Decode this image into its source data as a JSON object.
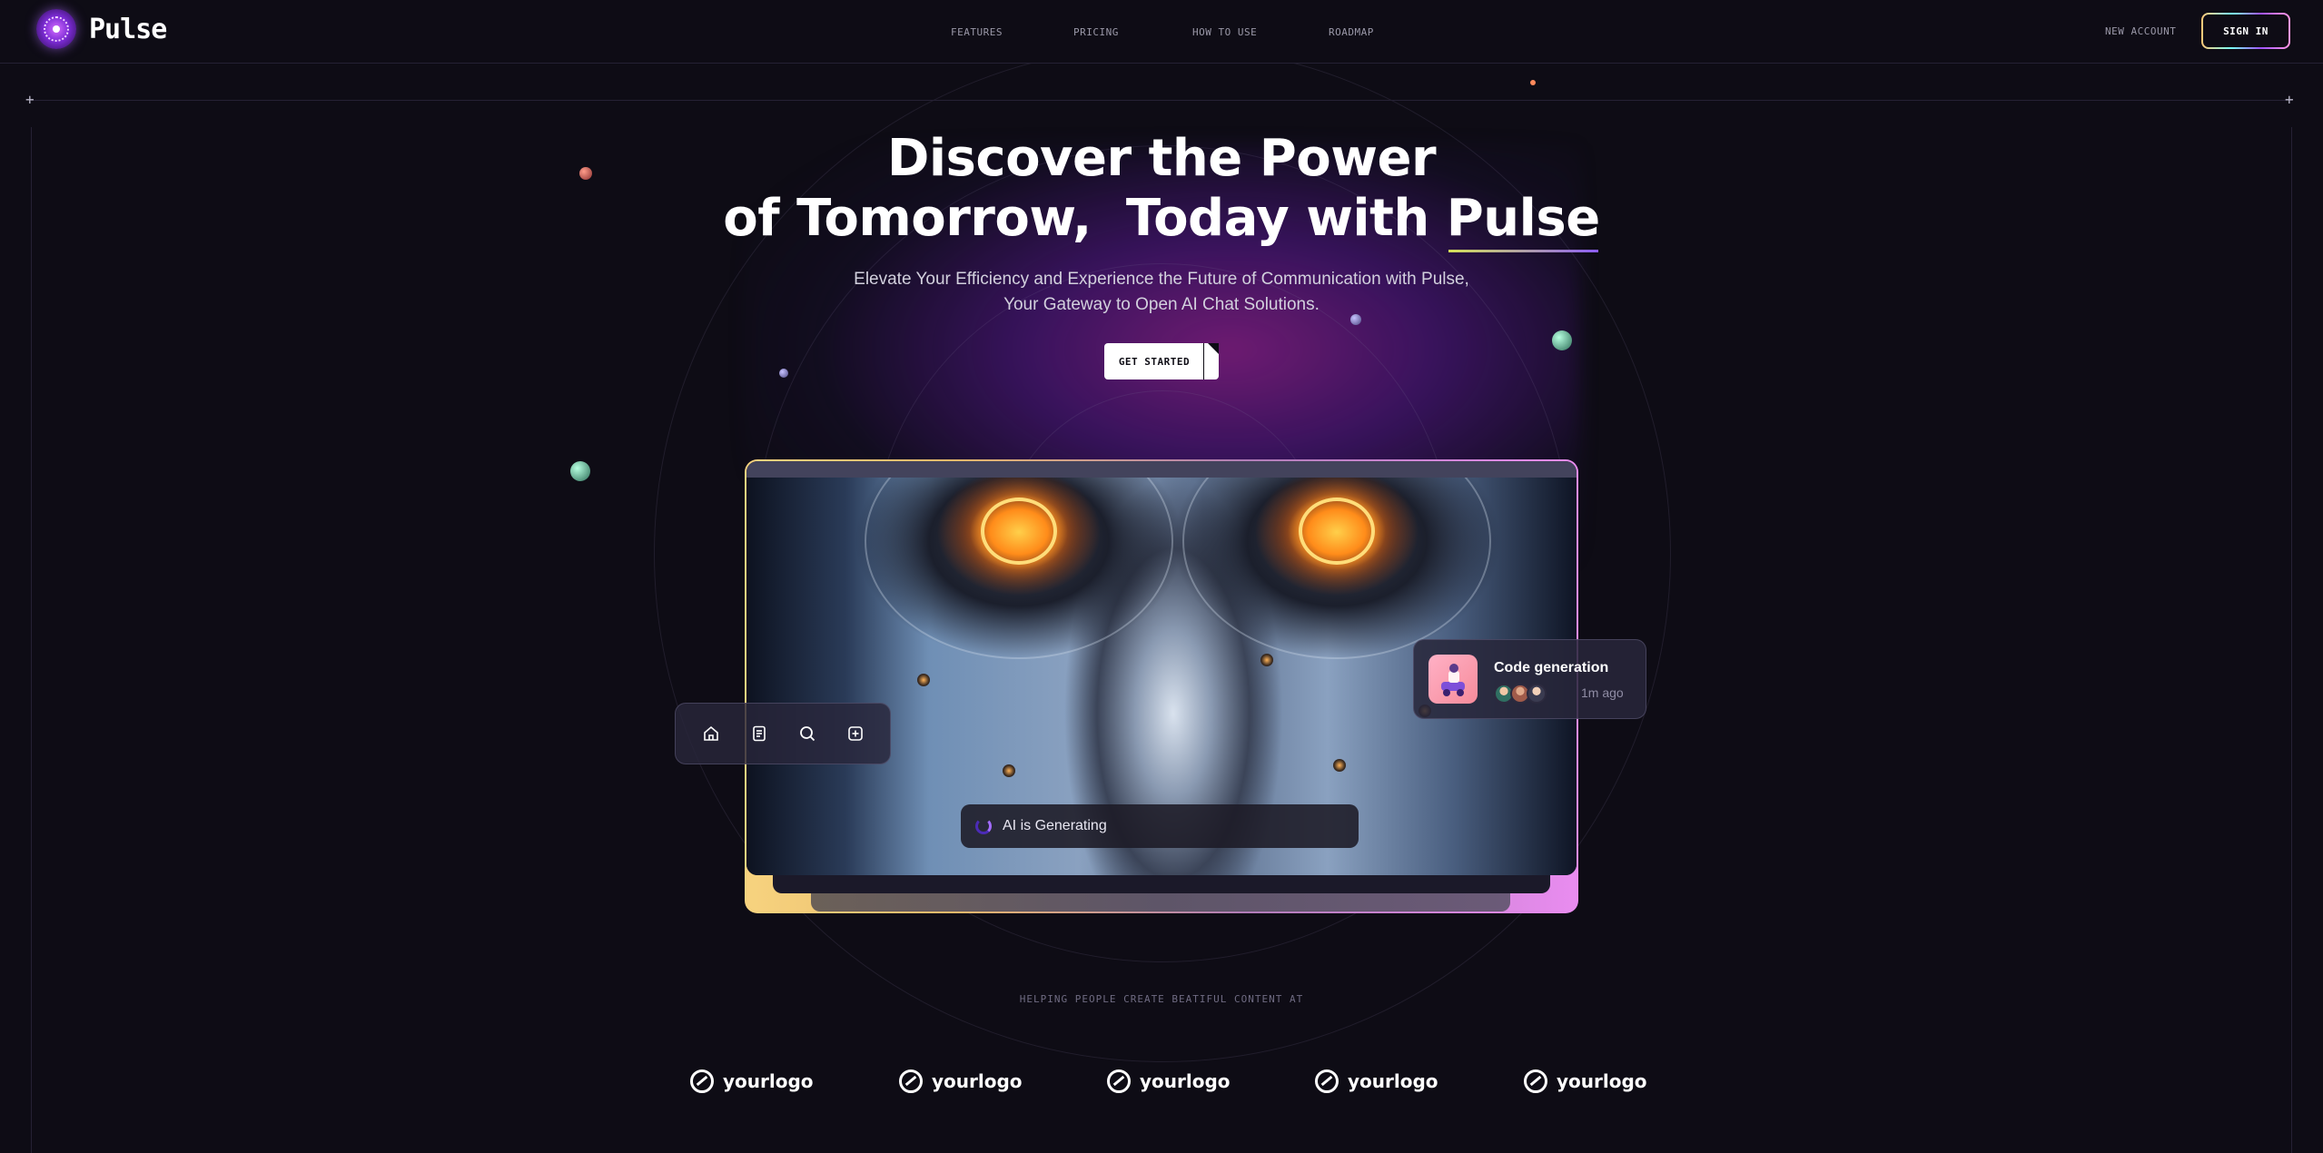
{
  "brand": {
    "name": "Pulse"
  },
  "nav": {
    "items": [
      "FEATURES",
      "PRICING",
      "HOW TO USE",
      "ROADMAP"
    ]
  },
  "header": {
    "new_account": "NEW ACCOUNT",
    "sign_in": "SIGN IN"
  },
  "hero": {
    "title_line1": "Discover the Power",
    "title_line2_prefix": "of Tomorrow,  Today with ",
    "title_accent": "Pulse",
    "subtitle": "Elevate Your Efficiency and Experience the Future of Communication with Pulse, Your Gateway to Open AI Chat Solutions.",
    "cta": "GET STARTED"
  },
  "toolbar": {
    "icons": [
      "home-icon",
      "document-icon",
      "search-icon",
      "plus-square-icon"
    ]
  },
  "generating": {
    "label": "AI is Generating"
  },
  "notification": {
    "title": "Code generation",
    "time": "1m ago"
  },
  "logos": {
    "caption": "HELPING PEOPLE CREATE BEATIFUL CONTENT AT",
    "items": [
      "yourlogo",
      "yourlogo",
      "yourlogo",
      "yourlogo",
      "yourlogo"
    ]
  },
  "colors": {
    "background": "#0e0c15",
    "accent_purple": "#ac6aff",
    "accent_yellow": "#ffc876",
    "accent_pink": "#ff98e2"
  }
}
